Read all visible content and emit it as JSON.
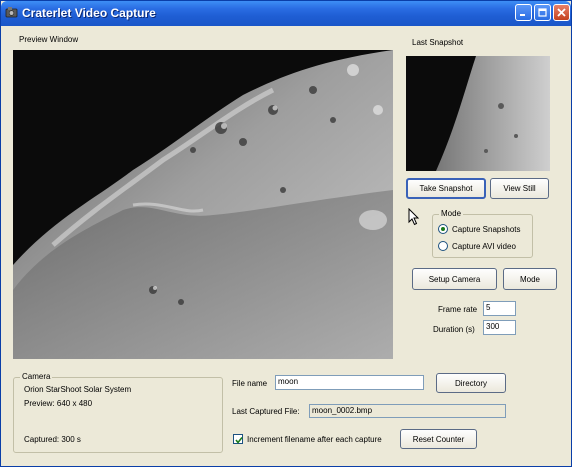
{
  "window": {
    "title": "Craterlet Video Capture",
    "title_color": "#2a6de3"
  },
  "preview": {
    "label": "Preview Window"
  },
  "snapshot": {
    "label": "Last Snapshot"
  },
  "buttons": {
    "take_snapshot": "Take Snapshot",
    "view_still": "View Still",
    "setup_camera": "Setup Camera",
    "mode": "Mode",
    "directory": "Directory",
    "reset_counter": "Reset Counter"
  },
  "mode_group": {
    "legend": "Mode",
    "options": [
      {
        "label": "Capture Snapshots",
        "selected": true
      },
      {
        "label": "Capture AVI video",
        "selected": false
      }
    ]
  },
  "settings": {
    "frame_rate_label": "Frame rate",
    "frame_rate_value": "5",
    "duration_label": "Duration (s)",
    "duration_value": "300"
  },
  "camera_group": {
    "legend": "Camera",
    "name": "Orion StarShoot Solar System",
    "preview_size": "Preview: 640 x 480",
    "captured": "Captured: 300 s"
  },
  "file": {
    "name_label": "File name",
    "name_value": "moon",
    "last_captured_label": "Last Captured File:",
    "last_captured_value": "moon_0002.bmp",
    "increment_label": "Increment filename after each capture",
    "increment_checked": true
  },
  "icons": [
    "app-icon",
    "minimize-icon",
    "maximize-icon",
    "close-icon",
    "mouse-cursor-icon"
  ]
}
